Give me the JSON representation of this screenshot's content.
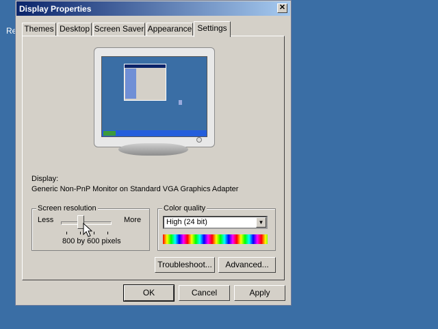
{
  "desktop": {
    "text": "Re"
  },
  "window": {
    "title": "Display Properties",
    "close_glyph": "✕"
  },
  "tabs": [
    {
      "label": "Themes"
    },
    {
      "label": "Desktop"
    },
    {
      "label": "Screen Saver"
    },
    {
      "label": "Appearance"
    },
    {
      "label": "Settings",
      "active": true
    }
  ],
  "display": {
    "label": "Display:",
    "adapter": "Generic Non-PnP Monitor on Standard VGA Graphics Adapter"
  },
  "resolution": {
    "legend": "Screen resolution",
    "less_label": "Less",
    "more_label": "More",
    "value_text": "800 by 600 pixels"
  },
  "color_quality": {
    "legend": "Color quality",
    "selected": "High (24 bit)",
    "arrow": "▼"
  },
  "buttons": {
    "troubleshoot": "Troubleshoot...",
    "advanced": "Advanced...",
    "ok": "OK",
    "cancel": "Cancel",
    "apply": "Apply"
  },
  "colors": {
    "desktop": "#3a6ea5",
    "dialog": "#d4d0c8",
    "title_start": "#0a246a",
    "title_end": "#a6caf0"
  }
}
